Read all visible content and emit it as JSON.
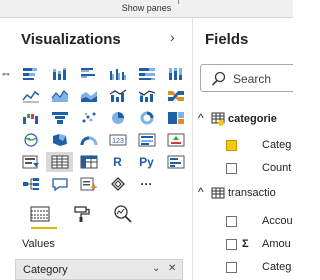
{
  "top_bar": {
    "label": "Show panes"
  },
  "visualizations": {
    "title": "Visualizations",
    "tabs": [
      "Fields",
      "Format",
      "Analytics"
    ],
    "values_label": "Values",
    "field_well": {
      "value": "Category"
    },
    "icons": [
      "stacked-bar-icon",
      "stacked-column-icon",
      "clustered-bar-icon",
      "clustered-column-icon",
      "100-stacked-bar-icon",
      "100-stacked-column-icon",
      "line-chart-icon",
      "area-chart-icon",
      "stacked-area-icon",
      "line-clustered-column-icon",
      "line-stacked-column-icon",
      "ribbon-chart-icon",
      "waterfall-icon",
      "funnel-icon",
      "scatter-icon",
      "pie-icon",
      "donut-icon",
      "treemap-icon",
      "map-icon",
      "filled-map-icon",
      "gauge-icon",
      "card-icon",
      "multi-row-card-icon",
      "kpi-icon",
      "slicer-icon",
      "table-icon",
      "matrix-icon",
      "r-visual-icon",
      "python-visual-icon",
      "key-influencers-icon",
      "decomposition-tree-icon",
      "qa-icon",
      "smart-narrative-icon",
      "power-apps-icon",
      "more-icon"
    ]
  },
  "fields": {
    "title": "Fields",
    "search": {
      "placeholder": "Search"
    },
    "tables": [
      {
        "name": "categorie",
        "items": [
          {
            "label": "Categ",
            "checked": true
          },
          {
            "label": "Count",
            "checked": false
          }
        ]
      },
      {
        "name": "transactio",
        "items": [
          {
            "label": "Accou",
            "checked": false
          },
          {
            "label": "Amou",
            "checked": false
          },
          {
            "label": "Categ",
            "checked": false
          }
        ]
      }
    ]
  },
  "colors": {
    "accent": "#f2c811",
    "blue": "#1f5fa8",
    "light_blue": "#7fb2e5"
  }
}
